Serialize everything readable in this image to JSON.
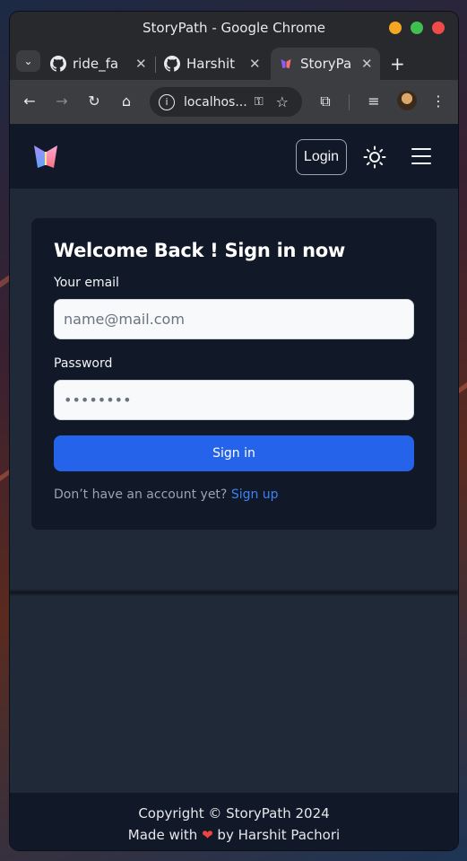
{
  "browser": {
    "window_title": "StoryPath - Google Chrome",
    "tabs": [
      {
        "label": "ride_fa",
        "icon": "github-icon"
      },
      {
        "label": "Harshit",
        "icon": "github-icon"
      },
      {
        "label": "StoryPa",
        "icon": "butterfly-icon",
        "active": true
      }
    ],
    "new_tab": "+",
    "close_glyph": "✕",
    "address": "localhos..."
  },
  "navbar": {
    "login_label": "Login"
  },
  "form": {
    "title": "Welcome Back ! Sign in now",
    "email_label": "Your email",
    "email_placeholder": "name@mail.com",
    "password_label": "Password",
    "password_placeholder": "••••••••",
    "submit_label": "Sign in",
    "signup_prompt": "Don’t have an account yet?",
    "signup_link": "Sign up"
  },
  "footer": {
    "copyright": "Copyright © StoryPath 2024",
    "made_with_prefix": "Made with",
    "made_with_suffix": "by Harshit Pachori"
  },
  "colors": {
    "accent": "#2563eb",
    "link": "#3b82f6",
    "heart": "#ef4444",
    "navbar_bg": "#111827",
    "page_bg": "#1f2937"
  }
}
